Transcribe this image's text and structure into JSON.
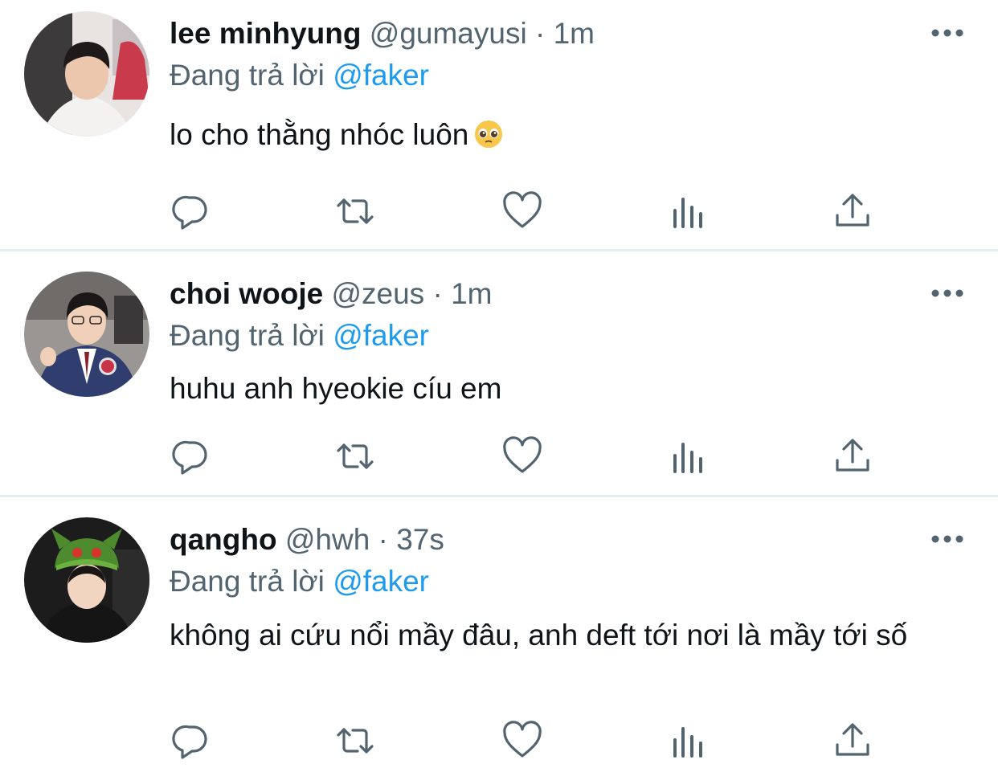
{
  "colors": {
    "text_primary": "#0f1419",
    "text_secondary": "#536471",
    "mention": "#1d9bf0",
    "divider": "#e6ecf0",
    "icon": "#536471"
  },
  "tweets": [
    {
      "name": "lee minhyung",
      "handle": "@gumayusi",
      "dot": "·",
      "time": "1m",
      "reply_prefix": "Đang trả lời",
      "reply_mention": "@faker",
      "text": "lo cho thằng nhóc luôn",
      "emoji": "pleading-face-emoji",
      "avatar": "avatar-photo",
      "more": "more-options-icon",
      "actions": [
        "reply-icon",
        "retweet-icon",
        "like-icon",
        "analytics-icon",
        "share-icon"
      ]
    },
    {
      "name": "choi wooje",
      "handle": "@zeus",
      "dot": "·",
      "time": "1m",
      "reply_prefix": "Đang trả lời",
      "reply_mention": "@faker",
      "text": "huhu anh hyeokie cíu em",
      "avatar": "avatar-photo",
      "more": "more-options-icon",
      "actions": [
        "reply-icon",
        "retweet-icon",
        "like-icon",
        "analytics-icon",
        "share-icon"
      ]
    },
    {
      "name": "qangho",
      "handle": "@hwh",
      "dot": "·",
      "time": "37s",
      "reply_prefix": "Đang trả lời",
      "reply_mention": "@faker",
      "text": "không ai cứu nổi mầy đâu, anh deft tới nơi là mầy tới số",
      "avatar": "avatar-photo",
      "more": "more-options-icon",
      "actions": [
        "reply-icon",
        "retweet-icon",
        "like-icon",
        "analytics-icon",
        "share-icon"
      ]
    }
  ]
}
